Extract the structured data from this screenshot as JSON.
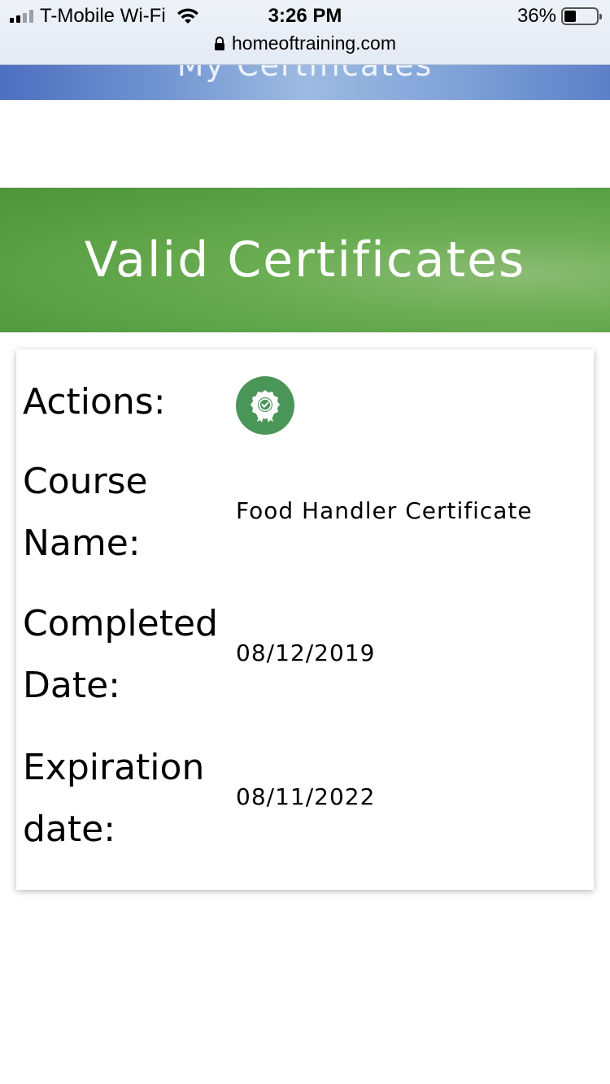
{
  "status_bar": {
    "carrier": "T-Mobile Wi-Fi",
    "time": "3:26 PM",
    "battery": "36%",
    "battery_level": 0.36,
    "url": "homeoftraining.com"
  },
  "banner": {
    "title": "My Certificates"
  },
  "section": {
    "title": "Valid Certificates",
    "color": "#5a9f43"
  },
  "certificate": {
    "actions_label": "Actions:",
    "action_icon": "certificate-badge-icon",
    "action_color": "#4a9558",
    "course_label_line1": "Course",
    "course_label_line2": "Name:",
    "course_name": "Food Handler Certificate",
    "completed_label_line1": "Completed",
    "completed_label_line2": "Date:",
    "completed_date": "08/12/2019",
    "expiration_label_line1": "Expiration",
    "expiration_label_line2": "date:",
    "expiration_date": "08/11/2022"
  }
}
